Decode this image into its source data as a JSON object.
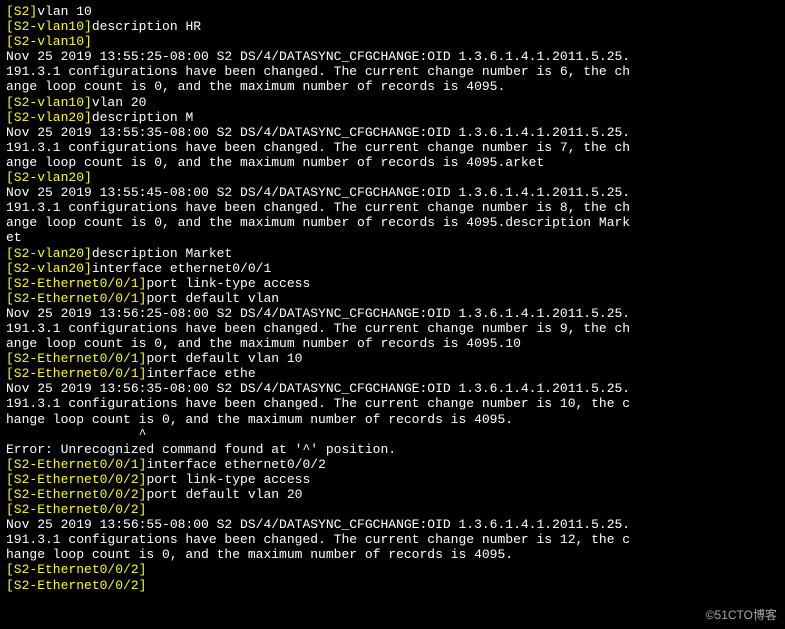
{
  "watermark": "©51CTO博客",
  "lines": [
    [
      {
        "c": "y",
        "t": "[S2]"
      },
      {
        "c": "w",
        "t": "vlan 10"
      }
    ],
    [
      {
        "c": "y",
        "t": "[S2-vlan10]"
      },
      {
        "c": "w",
        "t": "description HR"
      }
    ],
    [
      {
        "c": "y",
        "t": "[S2-vlan10]"
      }
    ],
    [
      {
        "c": "w",
        "t": "Nov 25 2019 13:55:25-08:00 S2 DS/4/DATASYNC_CFGCHANGE:OID 1.3.6.1.4.1.2011.5.25."
      }
    ],
    [
      {
        "c": "w",
        "t": "191.3.1 configurations have been changed. The current change number is 6, the ch"
      }
    ],
    [
      {
        "c": "w",
        "t": "ange loop count is 0, and the maximum number of records is 4095."
      }
    ],
    [
      {
        "c": "y",
        "t": "[S2-vlan10]"
      },
      {
        "c": "w",
        "t": "vlan 20"
      }
    ],
    [
      {
        "c": "y",
        "t": "[S2-vlan20]"
      },
      {
        "c": "w",
        "t": "description M"
      }
    ],
    [
      {
        "c": "w",
        "t": "Nov 25 2019 13:55:35-08:00 S2 DS/4/DATASYNC_CFGCHANGE:OID 1.3.6.1.4.1.2011.5.25."
      }
    ],
    [
      {
        "c": "w",
        "t": "191.3.1 configurations have been changed. The current change number is 7, the ch"
      }
    ],
    [
      {
        "c": "w",
        "t": "ange loop count is 0, and the maximum number of records is 4095.arket"
      }
    ],
    [
      {
        "c": "y",
        "t": "[S2-vlan20]"
      }
    ],
    [
      {
        "c": "w",
        "t": "Nov 25 2019 13:55:45-08:00 S2 DS/4/DATASYNC_CFGCHANGE:OID 1.3.6.1.4.1.2011.5.25."
      }
    ],
    [
      {
        "c": "w",
        "t": "191.3.1 configurations have been changed. The current change number is 8, the ch"
      }
    ],
    [
      {
        "c": "w",
        "t": "ange loop count is 0, and the maximum number of records is 4095.description Mark"
      }
    ],
    [
      {
        "c": "w",
        "t": "et"
      }
    ],
    [
      {
        "c": "y",
        "t": "[S2-vlan20]"
      },
      {
        "c": "w",
        "t": "description Market"
      }
    ],
    [
      {
        "c": "y",
        "t": "[S2-vlan20]"
      },
      {
        "c": "w",
        "t": "interface ethernet0/0/1"
      }
    ],
    [
      {
        "c": "y",
        "t": "[S2-Ethernet0/0/1]"
      },
      {
        "c": "w",
        "t": "port link-type access"
      }
    ],
    [
      {
        "c": "y",
        "t": "[S2-Ethernet0/0/1]"
      },
      {
        "c": "w",
        "t": "port default vlan"
      }
    ],
    [
      {
        "c": "w",
        "t": "Nov 25 2019 13:56:25-08:00 S2 DS/4/DATASYNC_CFGCHANGE:OID 1.3.6.1.4.1.2011.5.25."
      }
    ],
    [
      {
        "c": "w",
        "t": "191.3.1 configurations have been changed. The current change number is 9, the ch"
      }
    ],
    [
      {
        "c": "w",
        "t": "ange loop count is 0, and the maximum number of records is 4095.10"
      }
    ],
    [
      {
        "c": "y",
        "t": "[S2-Ethernet0/0/1]"
      },
      {
        "c": "w",
        "t": "port default vlan 10"
      }
    ],
    [
      {
        "c": "y",
        "t": "[S2-Ethernet0/0/1]"
      },
      {
        "c": "w",
        "t": "interface ethe"
      }
    ],
    [
      {
        "c": "w",
        "t": "Nov 25 2019 13:56:35-08:00 S2 DS/4/DATASYNC_CFGCHANGE:OID 1.3.6.1.4.1.2011.5.25."
      }
    ],
    [
      {
        "c": "w",
        "t": "191.3.1 configurations have been changed. The current change number is 10, the c"
      }
    ],
    [
      {
        "c": "w",
        "t": "hange loop count is 0, and the maximum number of records is 4095."
      }
    ],
    [
      {
        "c": "w",
        "t": "                 ^"
      }
    ],
    [
      {
        "c": "w",
        "t": "Error: Unrecognized command found at '^' position."
      }
    ],
    [
      {
        "c": "y",
        "t": "[S2-Ethernet0/0/1]"
      },
      {
        "c": "w",
        "t": "interface ethernet0/0/2"
      }
    ],
    [
      {
        "c": "y",
        "t": "[S2-Ethernet0/0/2]"
      },
      {
        "c": "w",
        "t": "port link-type access"
      }
    ],
    [
      {
        "c": "y",
        "t": "[S2-Ethernet0/0/2]"
      },
      {
        "c": "w",
        "t": "port default vlan 20"
      }
    ],
    [
      {
        "c": "y",
        "t": "[S2-Ethernet0/0/2]"
      }
    ],
    [
      {
        "c": "w",
        "t": "Nov 25 2019 13:56:55-08:00 S2 DS/4/DATASYNC_CFGCHANGE:OID 1.3.6.1.4.1.2011.5.25."
      }
    ],
    [
      {
        "c": "w",
        "t": "191.3.1 configurations have been changed. The current change number is 12, the c"
      }
    ],
    [
      {
        "c": "w",
        "t": "hange loop count is 0, and the maximum number of records is 4095."
      }
    ],
    [
      {
        "c": "y",
        "t": "[S2-Ethernet0/0/2]"
      }
    ],
    [
      {
        "c": "y",
        "t": "[S2-Ethernet0/0/2]"
      }
    ]
  ]
}
